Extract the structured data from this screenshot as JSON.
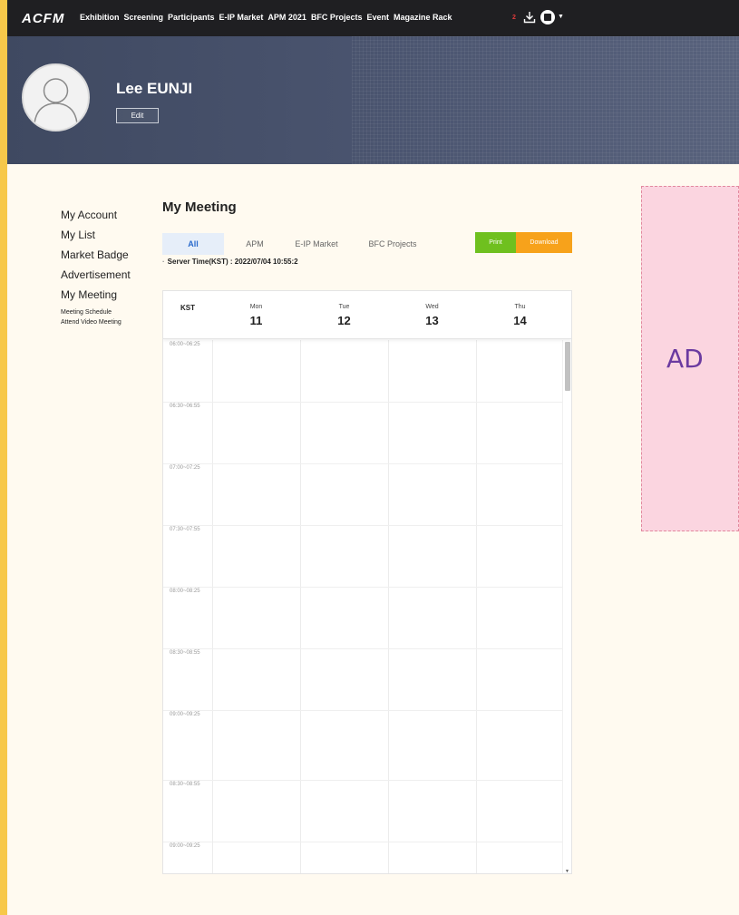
{
  "nav": {
    "logo": "ACFM",
    "items": [
      "Exhibition",
      "Screening",
      "Participants",
      "E-IP Market",
      "APM 2021",
      "BFC Projects",
      "Event",
      "Magazine Rack"
    ],
    "badge_count": "2",
    "icons": [
      "download-icon",
      "user-icon",
      "caret-down-icon"
    ]
  },
  "profile": {
    "name": "Lee EUNJI",
    "edit_label": "Edit"
  },
  "sidebar": {
    "items": [
      "My Account",
      "My List",
      "Market Badge",
      "Advertisement",
      "My Meeting"
    ],
    "subitems": [
      "Meeting Schedule",
      "Attend Video Meeting"
    ]
  },
  "main": {
    "title": "My Meeting",
    "tabs": [
      "All",
      "APM",
      "E-IP Market",
      "BFC Projects"
    ],
    "active_tab": "All",
    "print_label": "Print",
    "download_label": "Download",
    "server_time": "Server Time(KST) : 2022/07/04 10:55:2"
  },
  "calendar": {
    "timezone_label": "KST",
    "days": [
      {
        "name": "Mon",
        "num": "11"
      },
      {
        "name": "Tue",
        "num": "12"
      },
      {
        "name": "Wed",
        "num": "13"
      },
      {
        "name": "Thu",
        "num": "14"
      }
    ],
    "time_slots": [
      "06:00~06:25",
      "06:30~06:55",
      "07:00~07:25",
      "07:30~07:55",
      "08:00~08:25",
      "08:30~08:55",
      "09:00~09:25",
      "08:30~08:55",
      "09:00~09:25"
    ]
  },
  "ad": {
    "label": "AD"
  },
  "colors": {
    "nav_bg": "#1f1f22",
    "banner": "#4b5570",
    "print": "#6fc01f",
    "download": "#f7a21b",
    "active_tab": "#2a6acc",
    "ad_bg": "#fbd5e0",
    "ad_text": "#6b3aa0"
  }
}
